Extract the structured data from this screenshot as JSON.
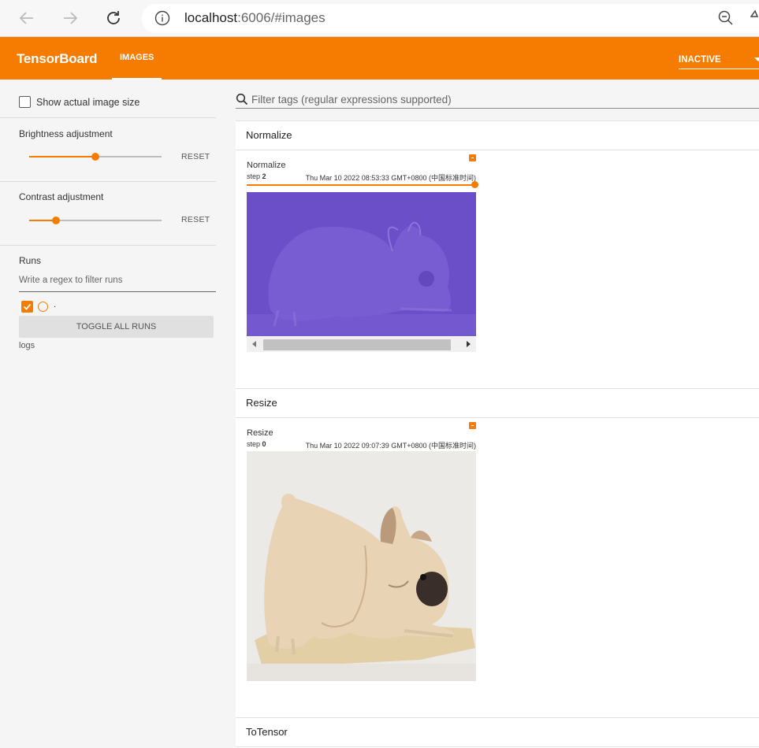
{
  "browser": {
    "url_host": "localhost",
    "url_rest": ":6006/#images"
  },
  "toolbar": {
    "brand": "TensorBoard",
    "tab": "IMAGES",
    "status": "INACTIVE"
  },
  "sidebar": {
    "show_actual_size": "Show actual image size",
    "brightness_label": "Brightness adjustment",
    "brightness_reset": "RESET",
    "brightness_value": 0.5,
    "contrast_label": "Contrast adjustment",
    "contrast_reset": "RESET",
    "contrast_value": 0.2,
    "runs_label": "Runs",
    "regex_placeholder": "Write a regex to filter runs",
    "run_name": ".",
    "toggle_all": "TOGGLE ALL RUNS",
    "logs": "logs"
  },
  "main": {
    "filter_placeholder": "Filter tags (regular expressions supported)",
    "panels": [
      {
        "title": "Normalize",
        "card_title": "Normalize",
        "step_label": "step",
        "step_value": "2",
        "timestamp": "Thu Mar 10 2022 08:53:33 GMT+0800 (中国标准时间)"
      },
      {
        "title": "Resize",
        "card_title": "Resize",
        "step_label": "step",
        "step_value": "0",
        "timestamp": "Thu Mar 10 2022 09:07:39 GMT+0800 (中国标准时间)"
      },
      {
        "title": "ToTensor"
      }
    ]
  },
  "colors": {
    "accent": "#f57c00",
    "normalize_tint": "#6a4fc9"
  }
}
